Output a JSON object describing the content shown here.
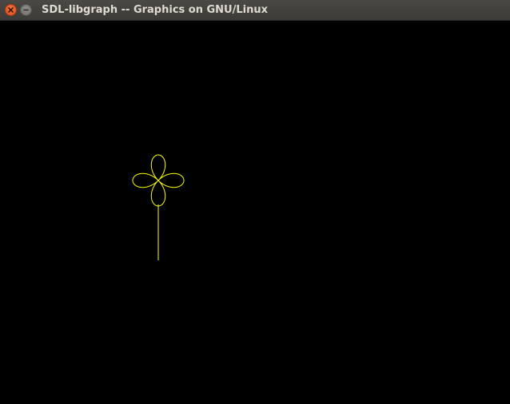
{
  "window": {
    "title": "SDL-libgraph -- Graphics on GNU/Linux",
    "buttons": [
      {
        "name": "close",
        "icon": "close-icon"
      },
      {
        "name": "minimize",
        "icon": "minimize-icon"
      }
    ]
  },
  "canvas": {
    "background_color": "#000000",
    "drawing": {
      "shape": "four-leaf clover with stem",
      "stroke_color": "#ffff00"
    }
  }
}
